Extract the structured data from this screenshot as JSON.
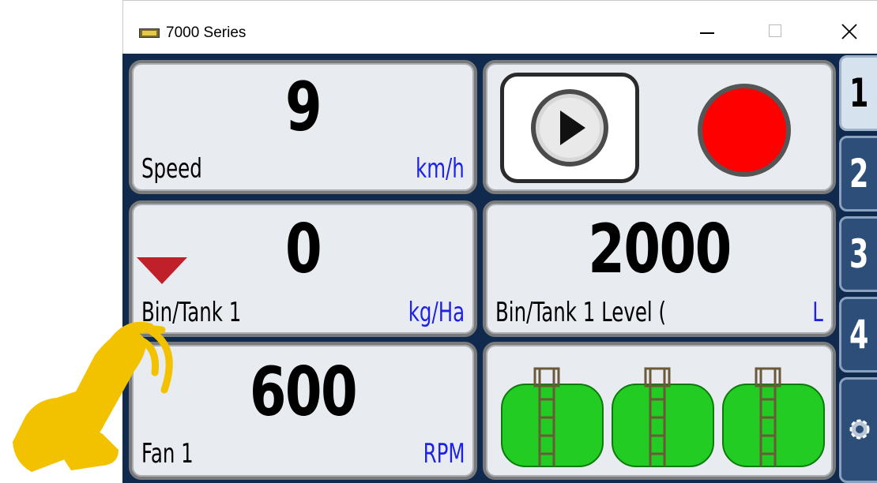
{
  "window": {
    "title": "7000 Series",
    "controls": {
      "minimize": "minimize",
      "maximize": "maximize",
      "close": "close"
    }
  },
  "panels": {
    "speed": {
      "value": "9",
      "label": "Speed",
      "unit": "km/h"
    },
    "bin": {
      "value": "0",
      "label": "Bin/Tank 1",
      "unit": "kg/Ha"
    },
    "fan": {
      "value": "600",
      "label": "Fan 1",
      "unit": "RPM"
    },
    "level": {
      "value": "2000",
      "label": "Bin/Tank 1 Level (",
      "unit": "L"
    }
  },
  "controls": {
    "play": "play-icon",
    "record": "record-icon"
  },
  "tanks": {
    "count": 3,
    "color": "#22cc22"
  },
  "tabs": [
    "1",
    "2",
    "3",
    "4"
  ],
  "colors": {
    "unit": "#1e22e6",
    "record": "#ff0000",
    "arrow": "#c0202a",
    "hand": "#f2c200"
  }
}
